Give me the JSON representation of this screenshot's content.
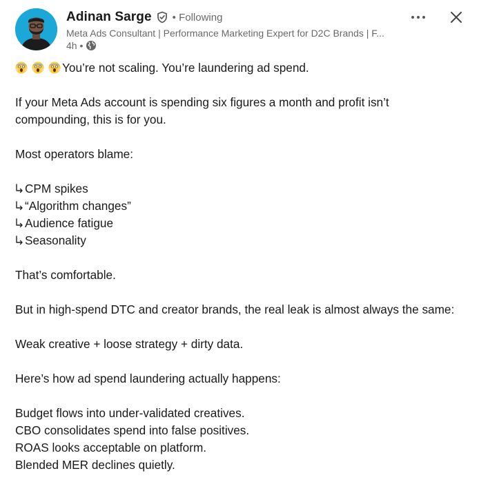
{
  "author": {
    "name": "Adinan Sarge",
    "following": "• Following",
    "headline": "Meta Ads Consultant | Performance Marketing Expert for D2C Brands | F...",
    "time": "4h •"
  },
  "post": {
    "line1": "You’re not scaling. You’re laundering ad spend.",
    "line2": "If your Meta Ads account is spending six figures a month and profit isn’t",
    "line3": "compounding, this is for you.",
    "line4": "Most operators blame:",
    "bullet1": "CPM spikes",
    "bullet2": "“Algorithm changes”",
    "bullet3": "Audience fatigue",
    "bullet4": "Seasonality",
    "line5": "That’s comfortable.",
    "line6": "But in high-spend DTC and creator brands, the real leak is almost always the same:",
    "line7": "Weak creative + loose strategy + dirty data.",
    "line8": "Here’s how ad spend laundering actually happens:",
    "line9": "Budget flows into under-validated creatives.",
    "line10": "CBO consolidates spend into false positives.",
    "line11": "ROAS looks acceptable on platform.",
    "line12": "Blended MER declines quietly."
  },
  "icons": {
    "verified": "shield-check-icon",
    "globe": "globe-icon",
    "more": "ellipsis-icon",
    "close": "close-icon",
    "emoji": "screaming-face-emoji",
    "bullet": "down-right-arrow-icon"
  },
  "colors": {
    "text": "#191919",
    "secondary": "#666666",
    "avatar_bg": "#1ba8d8"
  }
}
